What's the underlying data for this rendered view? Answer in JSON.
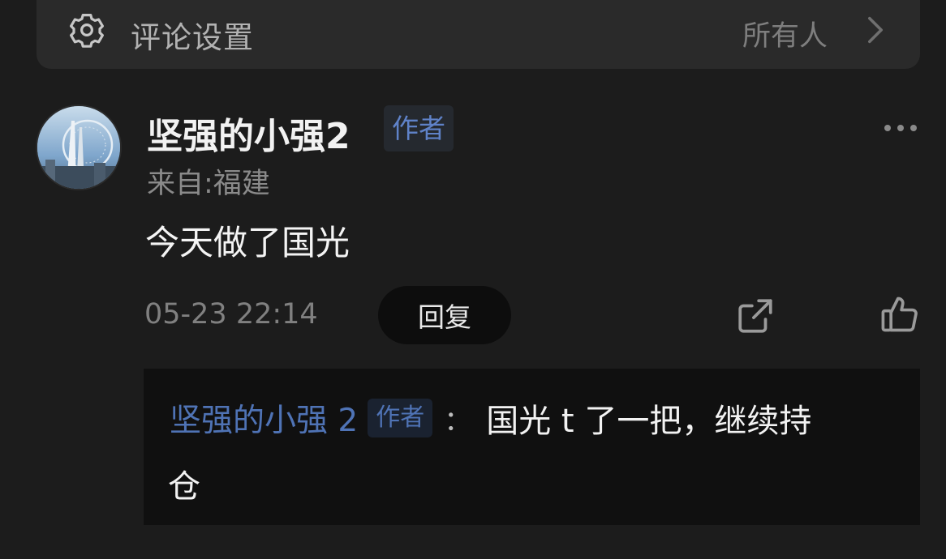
{
  "settings": {
    "label": "评论设置",
    "value": "所有人",
    "icons": {
      "settings": "gear-icon",
      "chevron": "chevron-right-icon"
    }
  },
  "comment": {
    "username": "坚强的小强2",
    "author_tag": "作者",
    "location": "来自:福建",
    "text": "今天做了国光",
    "timestamp": "05-23 22:14",
    "reply_label": "回复",
    "icons": {
      "more": "more-dots-icon",
      "share": "share-icon",
      "like": "thumbs-up-icon"
    }
  },
  "reply": {
    "username": "坚强的小强 2",
    "author_tag": "作者",
    "colon": "：",
    "text_line1": "国光 t 了一把，继续持",
    "text_line2": "仓"
  },
  "colors": {
    "background": "#1c1c1c",
    "accent_blue": "#4f73b5",
    "settings_bg": "#2a2a2a",
    "reply_bg": "#101010"
  }
}
